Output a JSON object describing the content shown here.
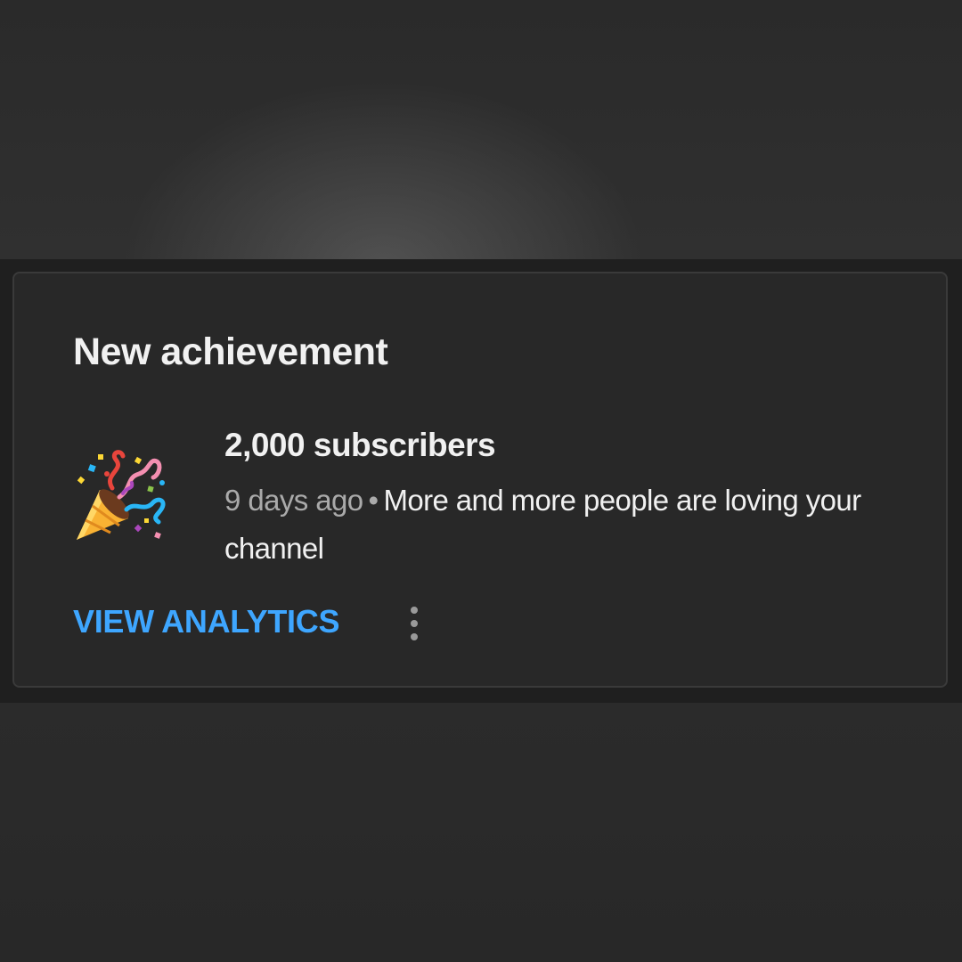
{
  "notification": {
    "title": "New achievement",
    "icon": "party-popper-icon",
    "item": {
      "title": "2,000 subscribers",
      "time": "9 days ago",
      "separator": "•",
      "message": "More and more people are loving your channel"
    },
    "action_label": "VIEW ANALYTICS",
    "more_icon": "more-vert-icon"
  },
  "colors": {
    "accent": "#3ea6ff",
    "card_background": "#282828",
    "text_primary": "#f1f1f1",
    "text_secondary": "#aaaaaa"
  }
}
